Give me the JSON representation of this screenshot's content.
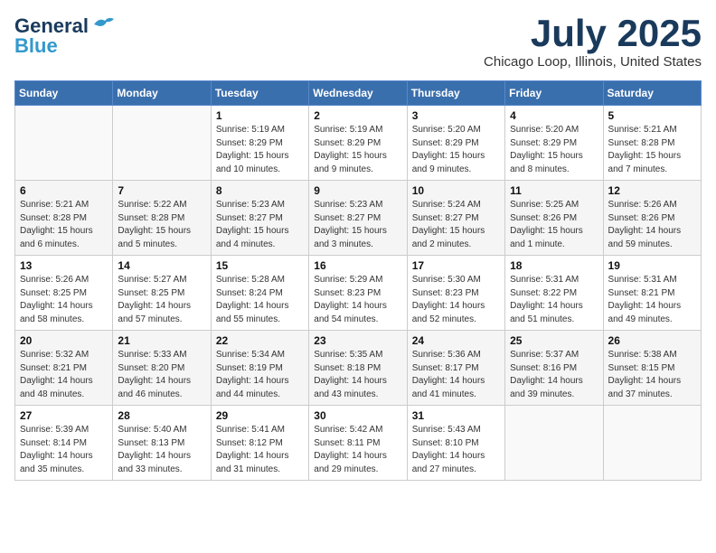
{
  "header": {
    "logo_general": "General",
    "logo_blue": "Blue",
    "month": "July 2025",
    "location": "Chicago Loop, Illinois, United States"
  },
  "weekdays": [
    "Sunday",
    "Monday",
    "Tuesday",
    "Wednesday",
    "Thursday",
    "Friday",
    "Saturday"
  ],
  "weeks": [
    [
      {
        "day": "",
        "sunrise": "",
        "sunset": "",
        "daylight": ""
      },
      {
        "day": "",
        "sunrise": "",
        "sunset": "",
        "daylight": ""
      },
      {
        "day": "1",
        "sunrise": "Sunrise: 5:19 AM",
        "sunset": "Sunset: 8:29 PM",
        "daylight": "Daylight: 15 hours and 10 minutes."
      },
      {
        "day": "2",
        "sunrise": "Sunrise: 5:19 AM",
        "sunset": "Sunset: 8:29 PM",
        "daylight": "Daylight: 15 hours and 9 minutes."
      },
      {
        "day": "3",
        "sunrise": "Sunrise: 5:20 AM",
        "sunset": "Sunset: 8:29 PM",
        "daylight": "Daylight: 15 hours and 9 minutes."
      },
      {
        "day": "4",
        "sunrise": "Sunrise: 5:20 AM",
        "sunset": "Sunset: 8:29 PM",
        "daylight": "Daylight: 15 hours and 8 minutes."
      },
      {
        "day": "5",
        "sunrise": "Sunrise: 5:21 AM",
        "sunset": "Sunset: 8:28 PM",
        "daylight": "Daylight: 15 hours and 7 minutes."
      }
    ],
    [
      {
        "day": "6",
        "sunrise": "Sunrise: 5:21 AM",
        "sunset": "Sunset: 8:28 PM",
        "daylight": "Daylight: 15 hours and 6 minutes."
      },
      {
        "day": "7",
        "sunrise": "Sunrise: 5:22 AM",
        "sunset": "Sunset: 8:28 PM",
        "daylight": "Daylight: 15 hours and 5 minutes."
      },
      {
        "day": "8",
        "sunrise": "Sunrise: 5:23 AM",
        "sunset": "Sunset: 8:27 PM",
        "daylight": "Daylight: 15 hours and 4 minutes."
      },
      {
        "day": "9",
        "sunrise": "Sunrise: 5:23 AM",
        "sunset": "Sunset: 8:27 PM",
        "daylight": "Daylight: 15 hours and 3 minutes."
      },
      {
        "day": "10",
        "sunrise": "Sunrise: 5:24 AM",
        "sunset": "Sunset: 8:27 PM",
        "daylight": "Daylight: 15 hours and 2 minutes."
      },
      {
        "day": "11",
        "sunrise": "Sunrise: 5:25 AM",
        "sunset": "Sunset: 8:26 PM",
        "daylight": "Daylight: 15 hours and 1 minute."
      },
      {
        "day": "12",
        "sunrise": "Sunrise: 5:26 AM",
        "sunset": "Sunset: 8:26 PM",
        "daylight": "Daylight: 14 hours and 59 minutes."
      }
    ],
    [
      {
        "day": "13",
        "sunrise": "Sunrise: 5:26 AM",
        "sunset": "Sunset: 8:25 PM",
        "daylight": "Daylight: 14 hours and 58 minutes."
      },
      {
        "day": "14",
        "sunrise": "Sunrise: 5:27 AM",
        "sunset": "Sunset: 8:25 PM",
        "daylight": "Daylight: 14 hours and 57 minutes."
      },
      {
        "day": "15",
        "sunrise": "Sunrise: 5:28 AM",
        "sunset": "Sunset: 8:24 PM",
        "daylight": "Daylight: 14 hours and 55 minutes."
      },
      {
        "day": "16",
        "sunrise": "Sunrise: 5:29 AM",
        "sunset": "Sunset: 8:23 PM",
        "daylight": "Daylight: 14 hours and 54 minutes."
      },
      {
        "day": "17",
        "sunrise": "Sunrise: 5:30 AM",
        "sunset": "Sunset: 8:23 PM",
        "daylight": "Daylight: 14 hours and 52 minutes."
      },
      {
        "day": "18",
        "sunrise": "Sunrise: 5:31 AM",
        "sunset": "Sunset: 8:22 PM",
        "daylight": "Daylight: 14 hours and 51 minutes."
      },
      {
        "day": "19",
        "sunrise": "Sunrise: 5:31 AM",
        "sunset": "Sunset: 8:21 PM",
        "daylight": "Daylight: 14 hours and 49 minutes."
      }
    ],
    [
      {
        "day": "20",
        "sunrise": "Sunrise: 5:32 AM",
        "sunset": "Sunset: 8:21 PM",
        "daylight": "Daylight: 14 hours and 48 minutes."
      },
      {
        "day": "21",
        "sunrise": "Sunrise: 5:33 AM",
        "sunset": "Sunset: 8:20 PM",
        "daylight": "Daylight: 14 hours and 46 minutes."
      },
      {
        "day": "22",
        "sunrise": "Sunrise: 5:34 AM",
        "sunset": "Sunset: 8:19 PM",
        "daylight": "Daylight: 14 hours and 44 minutes."
      },
      {
        "day": "23",
        "sunrise": "Sunrise: 5:35 AM",
        "sunset": "Sunset: 8:18 PM",
        "daylight": "Daylight: 14 hours and 43 minutes."
      },
      {
        "day": "24",
        "sunrise": "Sunrise: 5:36 AM",
        "sunset": "Sunset: 8:17 PM",
        "daylight": "Daylight: 14 hours and 41 minutes."
      },
      {
        "day": "25",
        "sunrise": "Sunrise: 5:37 AM",
        "sunset": "Sunset: 8:16 PM",
        "daylight": "Daylight: 14 hours and 39 minutes."
      },
      {
        "day": "26",
        "sunrise": "Sunrise: 5:38 AM",
        "sunset": "Sunset: 8:15 PM",
        "daylight": "Daylight: 14 hours and 37 minutes."
      }
    ],
    [
      {
        "day": "27",
        "sunrise": "Sunrise: 5:39 AM",
        "sunset": "Sunset: 8:14 PM",
        "daylight": "Daylight: 14 hours and 35 minutes."
      },
      {
        "day": "28",
        "sunrise": "Sunrise: 5:40 AM",
        "sunset": "Sunset: 8:13 PM",
        "daylight": "Daylight: 14 hours and 33 minutes."
      },
      {
        "day": "29",
        "sunrise": "Sunrise: 5:41 AM",
        "sunset": "Sunset: 8:12 PM",
        "daylight": "Daylight: 14 hours and 31 minutes."
      },
      {
        "day": "30",
        "sunrise": "Sunrise: 5:42 AM",
        "sunset": "Sunset: 8:11 PM",
        "daylight": "Daylight: 14 hours and 29 minutes."
      },
      {
        "day": "31",
        "sunrise": "Sunrise: 5:43 AM",
        "sunset": "Sunset: 8:10 PM",
        "daylight": "Daylight: 14 hours and 27 minutes."
      },
      {
        "day": "",
        "sunrise": "",
        "sunset": "",
        "daylight": ""
      },
      {
        "day": "",
        "sunrise": "",
        "sunset": "",
        "daylight": ""
      }
    ]
  ]
}
